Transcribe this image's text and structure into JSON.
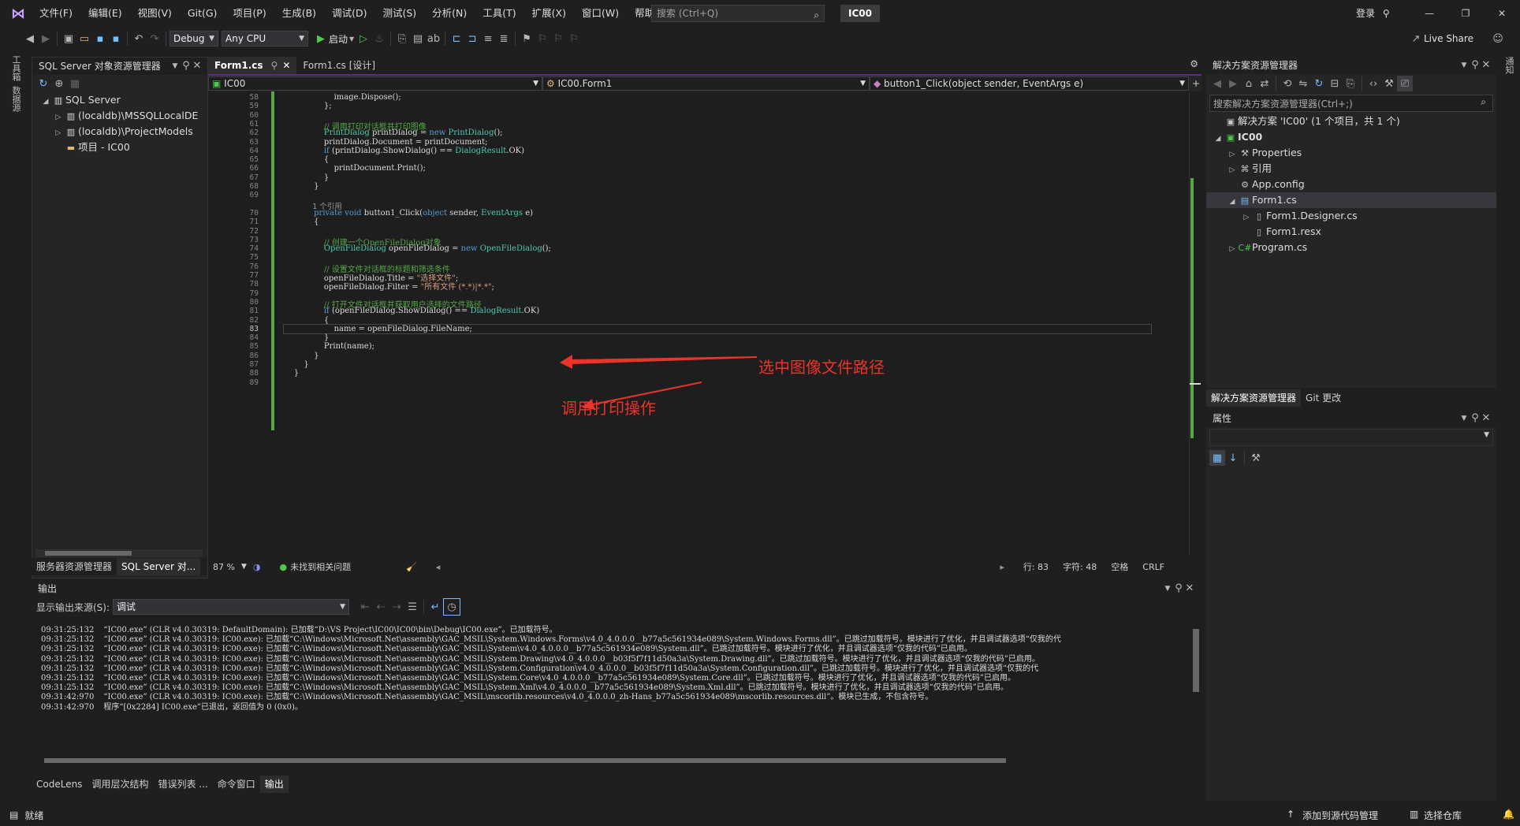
{
  "title_bar": {
    "menus": [
      "文件(F)",
      "编辑(E)",
      "视图(V)",
      "Git(G)",
      "项目(P)",
      "生成(B)",
      "调试(D)",
      "测试(S)",
      "分析(N)",
      "工具(T)",
      "扩展(X)",
      "窗口(W)",
      "帮助(H)"
    ],
    "search_placeholder": "搜索 (Ctrl+Q)",
    "solution_name": "IC00",
    "login": "登录"
  },
  "toolbar": {
    "config": "Debug",
    "platform": "Any CPU",
    "start_label": "启动",
    "live_share": "Live Share"
  },
  "left_strip": [
    "工具箱",
    "数据源"
  ],
  "sql_explorer": {
    "title": "SQL Server 对象资源管理器",
    "items": [
      {
        "label": "SQL Server",
        "icon": "server-icon"
      },
      {
        "label": "(localdb)\\MSSQLLocalDE",
        "icon": "db-server-icon"
      },
      {
        "label": "(localdb)\\ProjectModels",
        "icon": "db-server-icon"
      },
      {
        "label": "项目 - IC00",
        "icon": "folder-icon"
      }
    ],
    "tabs": [
      "服务器资源管理器",
      "SQL Server 对..."
    ]
  },
  "editor": {
    "tabs": [
      "Form1.cs",
      "Form1.cs [设计]"
    ],
    "nav": {
      "project": "IC00",
      "class": "IC00.Form1",
      "member": "button1_Click(object sender, EventArgs e)"
    },
    "code_lines": [
      {
        "n": "58",
        "html": "                    image.Dispose();"
      },
      {
        "n": "59",
        "html": "                };"
      },
      {
        "n": "60",
        "html": ""
      },
      {
        "n": "61",
        "html": "                // 调用打印对话框并打印图像"
      },
      {
        "n": "62",
        "html": "                PrintDialog printDialog = new PrintDialog();"
      },
      {
        "n": "63",
        "html": "                printDialog.Document = printDocument;"
      },
      {
        "n": "64",
        "html": "                if (printDialog.ShowDialog() == DialogResult.OK)"
      },
      {
        "n": "65",
        "html": "                {"
      },
      {
        "n": "66",
        "html": "                    printDocument.Print();"
      },
      {
        "n": "67",
        "html": "                }"
      },
      {
        "n": "68",
        "html": "            }"
      },
      {
        "n": "69",
        "html": ""
      },
      {
        "n": "",
        "html": "            1 个引用"
      },
      {
        "n": "70",
        "html": "            private void button1_Click(object sender, EventArgs e)"
      },
      {
        "n": "71",
        "html": "            {"
      },
      {
        "n": "72",
        "html": ""
      },
      {
        "n": "73",
        "html": "                // 创建一个OpenFileDialog对象"
      },
      {
        "n": "74",
        "html": "                OpenFileDialog openFileDialog = new OpenFileDialog();"
      },
      {
        "n": "75",
        "html": ""
      },
      {
        "n": "76",
        "html": "                // 设置文件对话框的标题和筛选条件"
      },
      {
        "n": "77",
        "html": "                openFileDialog.Title = \"选择文件\";"
      },
      {
        "n": "78",
        "html": "                openFileDialog.Filter = \"所有文件 (*.*)|*.*\";"
      },
      {
        "n": "79",
        "html": ""
      },
      {
        "n": "80",
        "html": "                // 打开文件对话框并获取用户选择的文件路径"
      },
      {
        "n": "81",
        "html": "                if (openFileDialog.ShowDialog() == DialogResult.OK)"
      },
      {
        "n": "82",
        "html": "                {"
      },
      {
        "n": "83",
        "html": "                    name = openFileDialog.FileName;"
      },
      {
        "n": "84",
        "html": "                }"
      },
      {
        "n": "85",
        "html": "                Print(name);"
      },
      {
        "n": "86",
        "html": "            }"
      },
      {
        "n": "87",
        "html": "        }"
      },
      {
        "n": "88",
        "html": "    }"
      },
      {
        "n": "89",
        "html": ""
      }
    ],
    "annotations": [
      "选中图像文件路径",
      "调用打印操作"
    ],
    "status": {
      "zoom": "87 %",
      "issues": "未找到相关问题",
      "line": "行: 83",
      "char": "字符: 48",
      "spaces": "空格",
      "eol": "CRLF"
    }
  },
  "solution_explorer": {
    "title": "解决方案资源管理器",
    "search_placeholder": "搜索解决方案资源管理器(Ctrl+;)",
    "items": [
      {
        "label": "解决方案 'IC00' (1 个项目，共 1 个)",
        "icon": "solution-icon"
      },
      {
        "label": "IC00",
        "icon": "csproj-icon"
      },
      {
        "label": "Properties",
        "icon": "wrench-icon"
      },
      {
        "label": "引用",
        "icon": "references-icon"
      },
      {
        "label": "App.config",
        "icon": "config-file-icon"
      },
      {
        "label": "Form1.cs",
        "icon": "form-icon"
      },
      {
        "label": "Form1.Designer.cs",
        "icon": "file-icon"
      },
      {
        "label": "Form1.resx",
        "icon": "file-icon"
      },
      {
        "label": "Program.cs",
        "icon": "csharp-icon"
      }
    ],
    "tabs": [
      "解决方案资源管理器",
      "Git 更改"
    ]
  },
  "properties": {
    "title": "属性"
  },
  "right_strip": [
    "通知"
  ],
  "output": {
    "title": "输出",
    "source_label": "显示输出来源(S):",
    "source_value": "调试",
    "lines": [
      [
        "09:31:25:132",
        "“IC00.exe” (CLR v4.0.30319: DefaultDomain): 已加载“D:\\VS Project\\IC00\\IC00\\bin\\Debug\\IC00.exe”。已加载符号。"
      ],
      [
        "09:31:25:132",
        "“IC00.exe” (CLR v4.0.30319: IC00.exe): 已加载“C:\\Windows\\Microsoft.Net\\assembly\\GAC_MSIL\\System.Windows.Forms\\v4.0_4.0.0.0__b77a5c561934e089\\System.Windows.Forms.dll”。已跳过加载符号。模块进行了优化，并且调试器选项“仅我的代"
      ],
      [
        "09:31:25:132",
        "“IC00.exe” (CLR v4.0.30319: IC00.exe): 已加载“C:\\Windows\\Microsoft.Net\\assembly\\GAC_MSIL\\System\\v4.0_4.0.0.0__b77a5c561934e089\\System.dll”。已跳过加载符号。模块进行了优化，并且调试器选项“仅我的代码”已启用。"
      ],
      [
        "09:31:25:132",
        "“IC00.exe” (CLR v4.0.30319: IC00.exe): 已加载“C:\\Windows\\Microsoft.Net\\assembly\\GAC_MSIL\\System.Drawing\\v4.0_4.0.0.0__b03f5f7f11d50a3a\\System.Drawing.dll”。已跳过加载符号。模块进行了优化，并且调试器选项“仅我的代码”已启用。"
      ],
      [
        "09:31:25:132",
        "“IC00.exe” (CLR v4.0.30319: IC00.exe): 已加载“C:\\Windows\\Microsoft.Net\\assembly\\GAC_MSIL\\System.Configuration\\v4.0_4.0.0.0__b03f5f7f11d50a3a\\System.Configuration.dll”。已跳过加载符号。模块进行了优化，并且调试器选项“仅我的代"
      ],
      [
        "09:31:25:132",
        "“IC00.exe” (CLR v4.0.30319: IC00.exe): 已加载“C:\\Windows\\Microsoft.Net\\assembly\\GAC_MSIL\\System.Core\\v4.0_4.0.0.0__b77a5c561934e089\\System.Core.dll”。已跳过加载符号。模块进行了优化，并且调试器选项“仅我的代码”已启用。"
      ],
      [
        "09:31:25:132",
        "“IC00.exe” (CLR v4.0.30319: IC00.exe): 已加载“C:\\Windows\\Microsoft.Net\\assembly\\GAC_MSIL\\System.Xml\\v4.0_4.0.0.0__b77a5c561934e089\\System.Xml.dll”。已跳过加载符号。模块进行了优化，并且调试器选项“仅我的代码”已启用。"
      ],
      [
        "09:31:42:970",
        "“IC00.exe” (CLR v4.0.30319: IC00.exe): 已加载“C:\\Windows\\Microsoft.Net\\assembly\\GAC_MSIL\\mscorlib.resources\\v4.0_4.0.0.0_zh-Hans_b77a5c561934e089\\mscorlib.resources.dll”。模块已生成，不包含符号。"
      ],
      [
        "09:31:42:970",
        "程序“[0x2284] IC00.exe”已退出，返回值为 0 (0x0)。"
      ]
    ]
  },
  "bottom_tabs": [
    "CodeLens",
    "调用层次结构",
    "错误列表 ...",
    "命令窗口",
    "输出"
  ],
  "statusbar": {
    "ready": "就绪",
    "add_source": "添加到源代码管理",
    "select_repo": "选择仓库"
  }
}
